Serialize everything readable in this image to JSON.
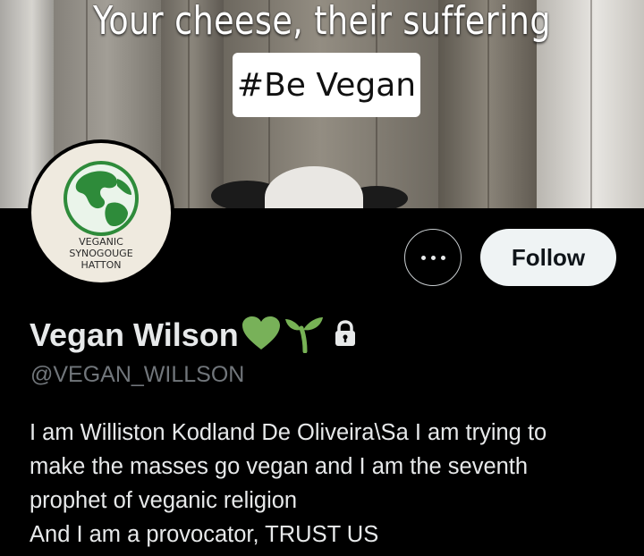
{
  "banner": {
    "headline": "Your cheese, their suffering",
    "hashtag": "#Be Vegan"
  },
  "avatar": {
    "lines": [
      "VEGANIC",
      "SYNOGOUGE",
      "HATTON"
    ]
  },
  "actions": {
    "more_icon": "ellipsis-icon",
    "follow_label": "Follow"
  },
  "profile": {
    "display_name": "Vegan Wilson",
    "name_emojis": [
      "green-heart-icon",
      "seedling-icon"
    ],
    "protected_icon": "lock-icon",
    "handle": "@VEGAN_WILLSON",
    "bio_lines": [
      "I am  Williston Kodland De Oliveira\\Sa I am trying to",
      "make the masses go vegan and I am the seventh",
      "prophet of veganic religion",
      "And I am a provocator, TRUST US"
    ]
  },
  "colors": {
    "background": "#000000",
    "text": "#e7e9ea",
    "muted": "#71767b",
    "follow_bg": "#eff3f4",
    "heart": "#78b159",
    "seedling": "#77b255"
  }
}
